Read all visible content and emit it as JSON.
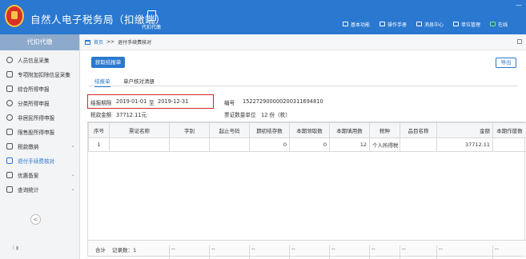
{
  "header": {
    "app_title": "自然人电子税务局（扣缴端）",
    "module_label": "代扣代缴",
    "links": [
      {
        "label": "基本功能",
        "icon": "panel-icon"
      },
      {
        "label": "操作手册",
        "icon": "book-icon"
      },
      {
        "label": "消息中心",
        "icon": "message-icon"
      },
      {
        "label": "单位管理",
        "icon": "building-icon"
      },
      {
        "label": "在线",
        "icon": "online-icon"
      }
    ],
    "window_minimize": "—"
  },
  "sidebar": {
    "title": "代扣代缴",
    "items": [
      {
        "label": "人员信息采集",
        "icon": "person-icon",
        "has_caret": false
      },
      {
        "label": "专项附加扣除信息采集",
        "icon": "list-icon",
        "has_caret": false
      },
      {
        "label": "综合所得申报",
        "icon": "layers-icon",
        "has_caret": false
      },
      {
        "label": "分类所得申报",
        "icon": "clock-icon",
        "has_caret": false
      },
      {
        "label": "非居民所得申报",
        "icon": "user-icon",
        "has_caret": false
      },
      {
        "label": "限售股所得申报",
        "icon": "bar-icon",
        "has_caret": false
      },
      {
        "label": "税款缴纳",
        "icon": "folder-icon",
        "has_caret": true
      },
      {
        "label": "退付手续费核对",
        "icon": "document-icon",
        "has_caret": false,
        "active": true
      },
      {
        "label": "优惠备案",
        "icon": "file-icon",
        "has_caret": true
      },
      {
        "label": "查询统计",
        "icon": "search-icon",
        "has_caret": true
      }
    ],
    "collapse_glyph": "<"
  },
  "breadcrumb": {
    "home": "首页",
    "separator": ">>",
    "current": "退付手续费核对"
  },
  "toolbar": {
    "primary_button": "获取结报单",
    "export_button": "导出"
  },
  "tabs": [
    {
      "label": "结报单",
      "active": true
    },
    {
      "label": "单户核对清册",
      "active": false
    }
  ],
  "info": {
    "period_label": "结报期限",
    "period_start": "2019-01-01",
    "period_to": "至",
    "period_end": "2019-12-31",
    "amount_label": "税款金额",
    "amount_value": "37712.11元",
    "code_label": "编号",
    "code_value": "152272900000200311694810",
    "voucher_label": "票证数量单位",
    "voucher_value": "12 份（枚）"
  },
  "table": {
    "columns": [
      "序号",
      "票证名称",
      "字别",
      "起止号码",
      "期初结存数",
      "本期领取数",
      "本期填用数",
      "税种",
      "品目名称",
      "金额",
      "本期作废数"
    ],
    "rows": [
      [
        "1",
        "",
        "",
        "",
        "0",
        "0",
        "12",
        "个人所得税",
        "",
        "37712.11",
        ""
      ]
    ],
    "footer": {
      "total_label": "合计",
      "count_label": "记录数：1",
      "dashes": "--"
    }
  }
}
